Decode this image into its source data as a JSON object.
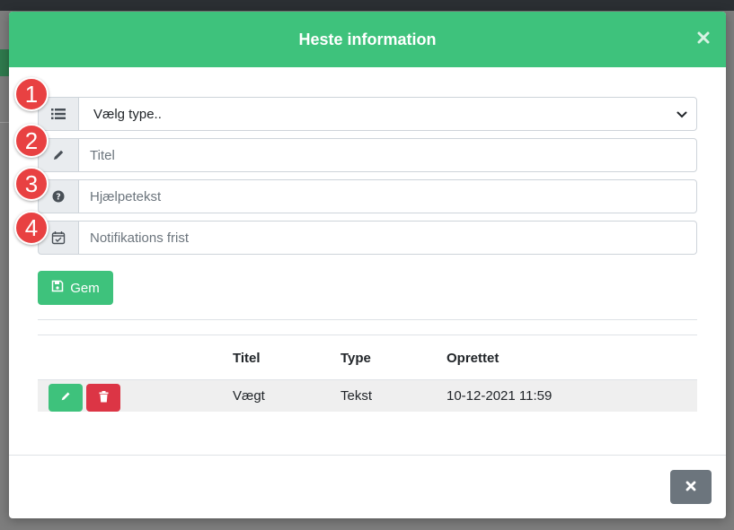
{
  "modal": {
    "title": "Heste information",
    "header_color": "#3ec27c"
  },
  "form": {
    "type_select": {
      "value": "Vælg type..",
      "icon": "list-icon"
    },
    "title_input": {
      "placeholder": "Titel",
      "icon": "pencil-icon"
    },
    "help_input": {
      "placeholder": "Hjælpetekst",
      "icon": "question-circle-icon"
    },
    "deadline_input": {
      "placeholder": "Notifikations frist",
      "icon": "calendar-check-icon"
    },
    "save_label": "Gem"
  },
  "badges": [
    "1",
    "2",
    "3",
    "4"
  ],
  "table": {
    "headers": {
      "title": "Titel",
      "type": "Type",
      "created": "Oprettet"
    },
    "rows": [
      {
        "title": "Vægt",
        "type": "Tekst",
        "created": "10-12-2021 11:59"
      }
    ]
  },
  "colors": {
    "success": "#3ec27c",
    "danger": "#dc3545",
    "secondary": "#6c757d",
    "badge": "#e84142"
  }
}
